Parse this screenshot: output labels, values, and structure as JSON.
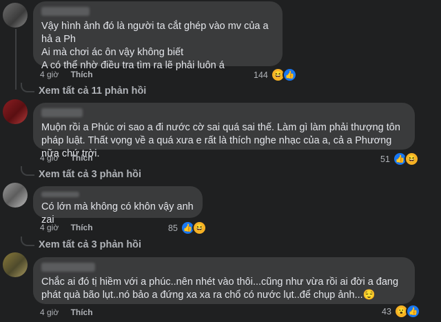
{
  "comments": [
    {
      "text": "Vậy hình ảnh đó là người ta cắt ghép vào mv của a hả a Ph\nAi mà chơi ác ôn vậy không biết\nA có thể nhờ điều tra tìm ra lẽ phải luôn á",
      "time": "4 giờ",
      "like_label": "Thích",
      "reaction_count": "144",
      "reactions": [
        "haha-icon",
        "like-icon"
      ]
    },
    {
      "text": "Muộn rồi a Phúc ơi sao a đi nước cờ sai quá sai thế. Làm gì làm phải thượng tôn pháp luật. Thất vọng về a quá xưa e rất là thích nghe nhạc của a, cả a Phương nữa chứ trời.",
      "time": "4 giờ",
      "like_label": "Thích",
      "reaction_count": "51",
      "reactions": [
        "like-icon",
        "haha-icon"
      ]
    },
    {
      "text": "Có lớn mà không có khôn vậy anh zai",
      "time": "4 giờ",
      "like_label": "Thích",
      "reaction_count": "85",
      "reactions": [
        "like-icon",
        "haha-icon"
      ]
    },
    {
      "text": "Chắc ai đó tị hiềm với a phúc..nên nhét vào thôi...cũng như vừa rồi ai đời a đang phát quà bão lụt..nó bảo a đứng xa xa ra chổ có nước lụt..để chụp ảnh...😌",
      "time": "4 giờ",
      "like_label": "Thích",
      "reaction_count": "43",
      "reactions": [
        "wow-icon",
        "like-icon"
      ]
    }
  ],
  "view_more": [
    "Xem tất cả 11 phản hồi",
    "Xem tất cả 3 phản hồi",
    "Xem tất cả 3 phản hồi"
  ]
}
